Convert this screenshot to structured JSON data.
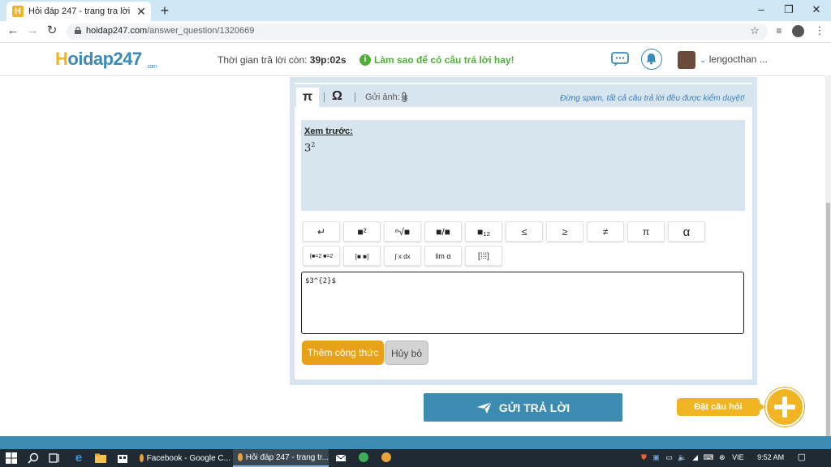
{
  "browser": {
    "tab_title": "Hỏi đáp 247 - trang tra lời",
    "tab_close": "✕",
    "new_tab": "+",
    "url_domain": "hoidap247.com",
    "url_path": "/answer_question/1320669"
  },
  "header": {
    "logo_h": "H",
    "logo_rest": "oidap247",
    "logo_com": ".com",
    "timer_label": "Thời gian trả lời còn: ",
    "timer_value": "39p:02s",
    "tip_icon": "i",
    "tip_text": "Làm sao để có câu trả lời hay!",
    "username": "lengocthan ..."
  },
  "editor": {
    "pi_tab": "π",
    "omega_tab": "Ω",
    "send_image_label": "Gửi ảnh:",
    "notice": "Đừng spam, tất cả câu trả lời đều được kiểm duyệt!",
    "preview_label": "Xem trước:",
    "preview_base": "3",
    "preview_exp": "2",
    "math_buttons_row1": [
      "↵",
      "■²",
      "ⁿ√■",
      "■/■",
      "■₁₂",
      "≤",
      "≥",
      "≠",
      "π",
      "α"
    ],
    "math_buttons_row2": [
      "{■=2 ■=2",
      "[■ ■]",
      "∫ x dx",
      "lim α",
      "[⁞⁞⁞]"
    ],
    "latex_value": "$3^{2}$",
    "add_formula": "Thêm công thức",
    "cancel": "Hủy bỏ"
  },
  "actions": {
    "submit": "GỬI TRẢ LỜI",
    "ask_question": "Đặt câu hỏi"
  },
  "taskbar": {
    "app1": "Facebook - Google C...",
    "app2": "Hỏi đáp 247 - trang tr...",
    "lang": "VIE",
    "time": "9:52 AM"
  },
  "colors": {
    "brand_blue": "#3c8cb1",
    "brand_yellow": "#f1b422",
    "tip_green": "#4fae3a"
  }
}
